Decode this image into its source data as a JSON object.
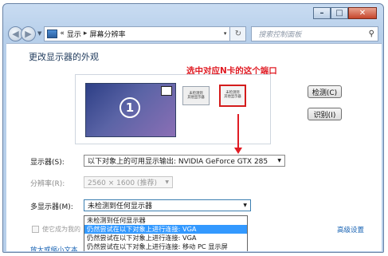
{
  "window": {
    "buttons": {
      "minimize": "–",
      "maximize": "□",
      "close": "✕"
    }
  },
  "nav": {
    "address": {
      "prefix": "«",
      "crumb1": "显示",
      "sep": "▸",
      "crumb2": "屏幕分辨率",
      "dropdown": "▾"
    },
    "refresh_glyph": "↻",
    "search_placeholder": "搜索控制面板",
    "search_glyph": "⚲"
  },
  "page": {
    "title": "更改显示器的外观",
    "annotation": "选中对应N卡的这个端口",
    "monitor_number": "1",
    "mini_left": {
      "line1": "未检测到",
      "line2": "其他显示器"
    },
    "mini_right": {
      "line1": "未检测到",
      "line2": "其他显示器"
    },
    "detect_button": "检测(C)",
    "identify_button": "识别(I)"
  },
  "settings": {
    "display_label": "显示器(S):",
    "display_value": "以下对象上的可用显示输出: NVIDIA GeForce GTX 285",
    "resolution_label": "分辨率(R):",
    "resolution_value": "2560 × 1600 (推荐)",
    "multi_label": "多显示器(M):",
    "multi_value": "未检测到任何显示器",
    "multi_options": [
      "未检测到任何显示器",
      "仍然尝试在以下对象上进行连接: VGA",
      "仍然尝试在以下对象上进行连接: VGA",
      "仍然尝试在以下对象上进行连接: 移动 PC 显示屏"
    ],
    "multi_selected_index": 1,
    "primary_checkbox_label": "使它成为我的",
    "advanced_link": "高级设置",
    "zoom_link": "放大或缩小文本"
  },
  "colors": {
    "annotation_red": "#e01c24",
    "highlight": "#3399ff",
    "link": "#1a64b4"
  }
}
